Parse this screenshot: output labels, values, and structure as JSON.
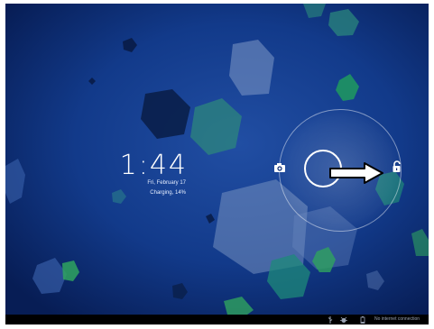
{
  "lockscreen": {
    "time": "1:44",
    "date": "Fri, February 17",
    "charging": "Charging, 14%"
  },
  "statusbar": {
    "network_text": "No internet connection"
  },
  "icons": {
    "camera": "camera-icon",
    "unlock": "unlock-icon",
    "usb": "usb-icon",
    "debug": "debug-icon",
    "battery": "battery-icon"
  },
  "colors": {
    "background": "#0b2a73",
    "ring": "#ffffff",
    "arrow_fill": "#ffffff",
    "arrow_stroke": "#000000"
  }
}
